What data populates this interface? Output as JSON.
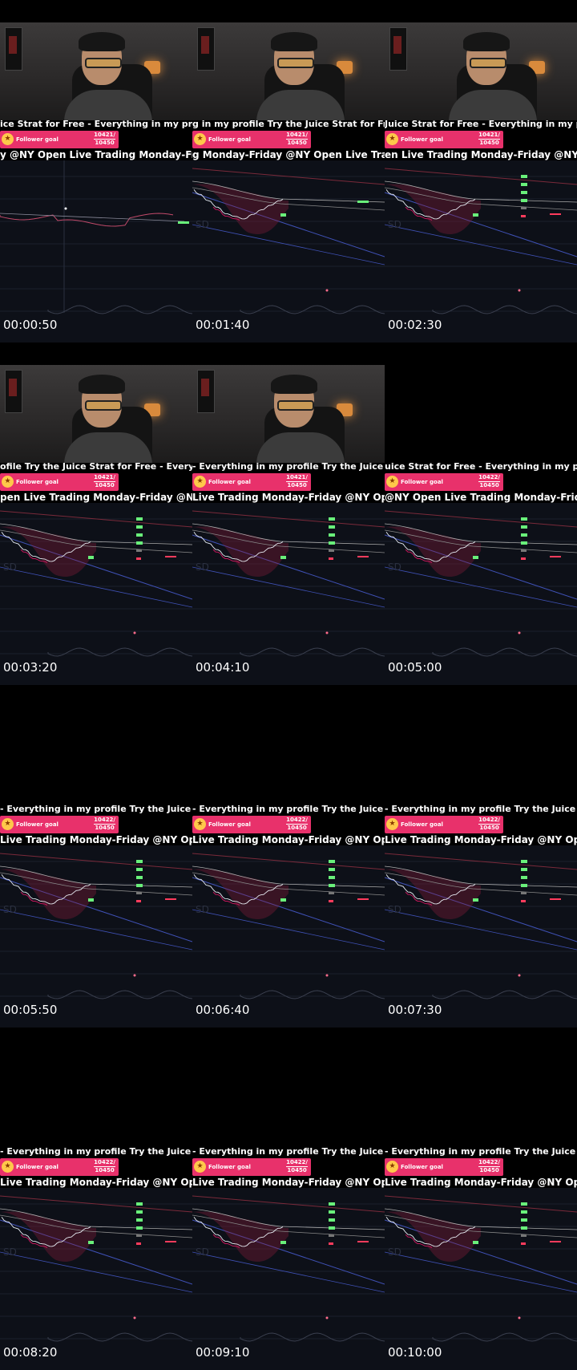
{
  "tiles": [
    {
      "timestamp": "00:00:50",
      "ticker_text": "ice Strat for Free - Everything in my profile",
      "subtitle": "y @NY Open    Live Trading Monday-Frida",
      "goal_label": "Follower goal",
      "goal_current": "10421/",
      "goal_target": "10450",
      "webcam": true,
      "chart_variant": "early"
    },
    {
      "timestamp": "00:01:40",
      "ticker_text": "g in my profile    Try the Juice Strat for Free -",
      "subtitle": "g Monday-Friday @NY Open    Live Tradi",
      "goal_label": "Follower goal",
      "goal_current": "10421/",
      "goal_target": "10450",
      "webcam": true,
      "chart_variant": "mid"
    },
    {
      "timestamp": "00:02:30",
      "ticker_text": "Juice Strat for Free - Everything in my profile",
      "subtitle": "en    Live Trading Monday-Friday @NY Op",
      "goal_label": "Follower goal",
      "goal_current": "10421/",
      "goal_target": "10450",
      "webcam": true,
      "chart_variant": "full"
    },
    {
      "timestamp": "00:03:20",
      "ticker_text": "ofile    Try the Juice Strat for Free - Everythin",
      "subtitle": "pen    Live Trading Monday-Friday @NY O",
      "goal_label": "Follower goal",
      "goal_current": "10421/",
      "goal_target": "10450",
      "webcam": true,
      "chart_variant": "full"
    },
    {
      "timestamp": "00:04:10",
      "ticker_text": "- Everything in my profile    Try the Juice Stra",
      "subtitle": "    Live Trading Monday-Friday @NY Ope",
      "goal_label": "Follower goal",
      "goal_current": "10421/",
      "goal_target": "10450",
      "webcam": true,
      "chart_variant": "full"
    },
    {
      "timestamp": "00:05:00",
      "ticker_text": "uice Strat for Free - Everything in my profile",
      "subtitle": "@NY Open    Live Trading Monday-Friday",
      "goal_label": "Follower goal",
      "goal_current": "10422/",
      "goal_target": "10450",
      "webcam": false,
      "chart_variant": "full"
    },
    {
      "timestamp": "00:05:50",
      "ticker_text": "- Everything in my profile    Try the Juice Str",
      "subtitle": " Live Trading Monday-Friday @NY Open",
      "goal_label": "Follower goal",
      "goal_current": "10422/",
      "goal_target": "10450",
      "webcam": false,
      "chart_variant": "full"
    },
    {
      "timestamp": "00:06:40",
      "ticker_text": "- Everything in my profile    Try the Juice Str",
      "subtitle": " Live Trading Monday-Friday @NY Open",
      "goal_label": "Follower goal",
      "goal_current": "10422/",
      "goal_target": "10450",
      "webcam": false,
      "chart_variant": "full"
    },
    {
      "timestamp": "00:07:30",
      "ticker_text": "- Everything in my profile    Try the Juice Str",
      "subtitle": " Live Trading Monday-Friday @NY Open",
      "goal_label": "Follower goal",
      "goal_current": "10422/",
      "goal_target": "10450",
      "webcam": false,
      "chart_variant": "full"
    },
    {
      "timestamp": "00:08:20",
      "ticker_text": "- Everything in my profile    Try the Juice Str",
      "subtitle": " Live Trading Monday-Friday @NY Open",
      "goal_label": "Follower goal",
      "goal_current": "10422/",
      "goal_target": "10450",
      "webcam": false,
      "chart_variant": "full"
    },
    {
      "timestamp": "00:09:10",
      "ticker_text": "- Everything in my profile    Try the Juice Str",
      "subtitle": " Live Trading Monday-Friday @NY Open",
      "goal_label": "Follower goal",
      "goal_current": "10422/",
      "goal_target": "10450",
      "webcam": false,
      "chart_variant": "full"
    },
    {
      "timestamp": "00:10:00",
      "ticker_text": "- Everything in my profile    Try the Juice Str",
      "subtitle": " Live Trading Monday-Friday @NY Open",
      "goal_label": "Follower goal",
      "goal_current": "10422/",
      "goal_target": "10450",
      "webcam": false,
      "chart_variant": "full"
    }
  ],
  "colors": {
    "goal_bg": "#e8316b",
    "chart_bg": "#0d1018",
    "candle_up": "#e9eef5",
    "candle_down": "#c2185b",
    "trend_line": "#3f51b5",
    "marker_green": "#69f07a",
    "marker_red": "#ff3b5c"
  }
}
